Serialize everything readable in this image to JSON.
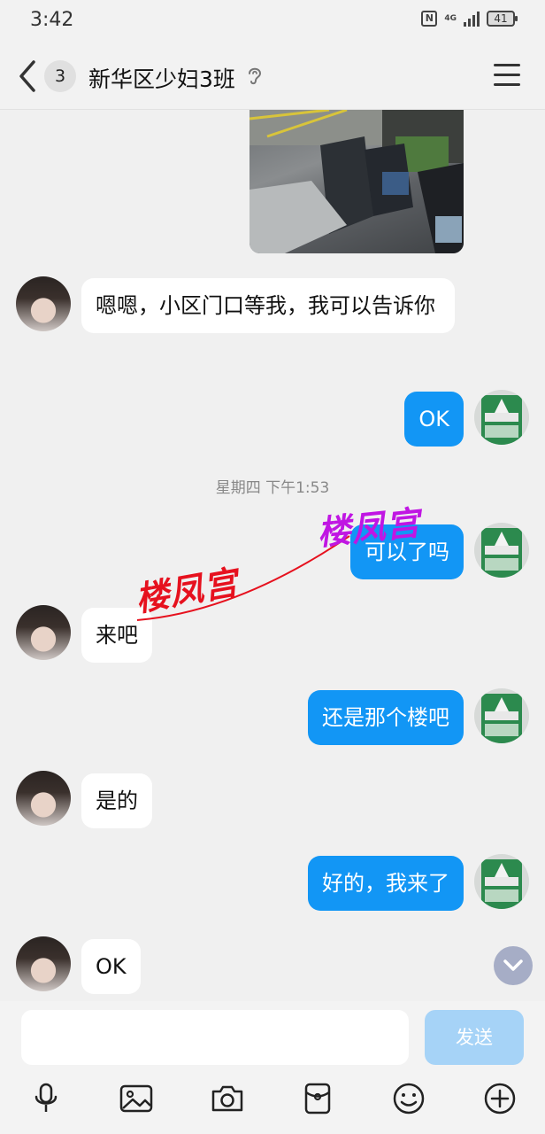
{
  "status_bar": {
    "time": "3:42",
    "network": "4G",
    "battery": "41"
  },
  "header": {
    "back_count": "3",
    "title": "新华区少妇3班"
  },
  "messages": [
    {
      "side": "in",
      "text": "嗯嗯，小区门口等我，我可以告诉你"
    },
    {
      "side": "out",
      "text": "OK"
    },
    {
      "side": "out",
      "text": "可以了吗"
    },
    {
      "side": "in",
      "text": "来吧"
    },
    {
      "side": "out",
      "text": "还是那个楼吧"
    },
    {
      "side": "in",
      "text": "是的"
    },
    {
      "side": "out",
      "text": "好的，我来了"
    },
    {
      "side": "in",
      "text": "OK"
    }
  ],
  "timestamp": "星期四 下午1:53",
  "watermarks": [
    "楼凤宫",
    "楼凤宫"
  ],
  "input": {
    "placeholder": "",
    "send_label": "发送"
  },
  "toolbar": [
    "microphone-icon",
    "image-icon",
    "camera-icon",
    "red-packet-icon",
    "emoji-icon",
    "plus-icon"
  ],
  "colors": {
    "outgoing_bubble": "#1296f5",
    "send_button": "#a6d3f7",
    "background": "#f0f0f0"
  }
}
